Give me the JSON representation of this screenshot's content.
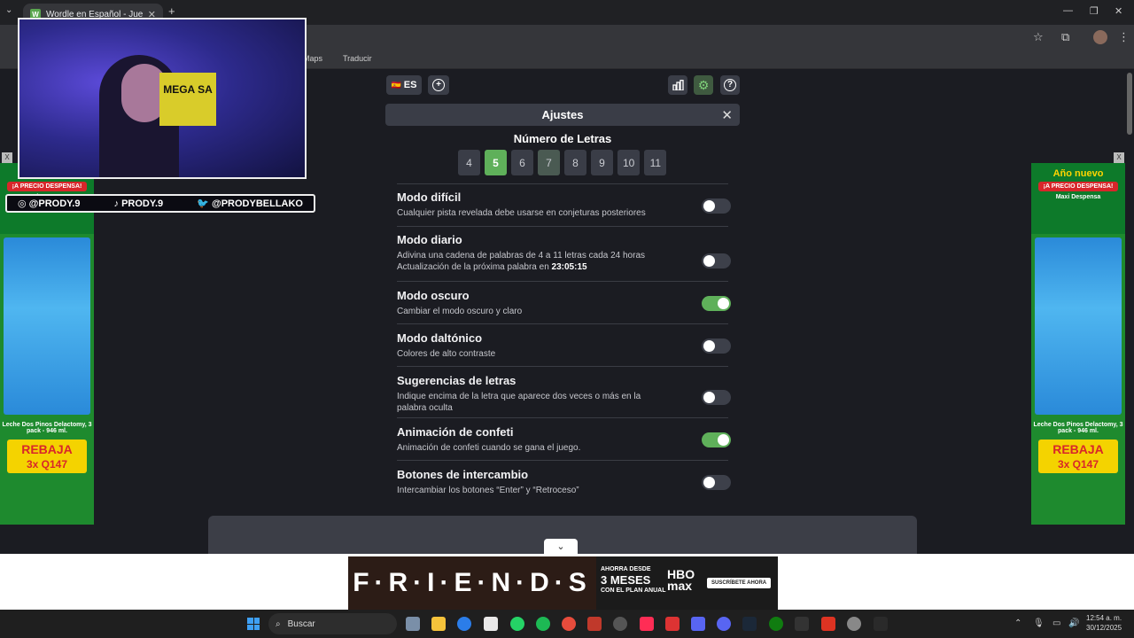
{
  "browser": {
    "tab_title": "Wordle en Español - Juega Wo...",
    "tab_favicon": "W",
    "tab_close": "✕",
    "new_tab": "+",
    "bookmarks": [
      "Maps",
      "Traducir"
    ],
    "window_controls": [
      "—",
      "❐",
      "✕"
    ]
  },
  "toolbar": {
    "lang_flag": "🇪🇸",
    "lang_label": "ES",
    "add_icon": "+",
    "stats_icon": "stats-icon",
    "settings_icon": "gear-icon",
    "help_icon": "?"
  },
  "panel": {
    "title": "Ajustes",
    "close": "✕",
    "letters_title": "Número de Letras",
    "letter_options": [
      "4",
      "5",
      "6",
      "7",
      "8",
      "9",
      "10",
      "11"
    ],
    "selected_letters": "5"
  },
  "settings": [
    {
      "title": "Modo difícil",
      "desc": "Cualquier pista revelada debe usarse en conjeturas posteriores",
      "on": false
    },
    {
      "title": "Modo diario",
      "desc": "Adivina una cadena de palabras de 4 a 11 letras cada 24 horas",
      "desc2_prefix": "Actualización de la próxima palabra en ",
      "desc2_time": "23:05:15",
      "on": false
    },
    {
      "title": "Modo oscuro",
      "desc": "Cambiar el modo oscuro y claro",
      "on": true
    },
    {
      "title": "Modo daltónico",
      "desc": "Colores de alto contraste",
      "on": false
    },
    {
      "title": "Sugerencias de letras",
      "desc": "Indique encima de la letra que aparece dos veces o más en la palabra oculta",
      "on": false
    },
    {
      "title": "Animación de confeti",
      "desc": "Animación de confeti cuando se gana el juego.",
      "on": true
    },
    {
      "title": "Botones de intercambio",
      "desc": "Intercambiar los botones “Enter” y “Retroceso”",
      "on": false
    }
  ],
  "ads": {
    "side_header": "Año nuevo",
    "side_tag": "¡A PRECIO DESPENSA!",
    "side_brand": "Maxi Despensa",
    "side_desc": "Leche Dos Pinos Delactomy, 3 pack - 946 ml.",
    "side_rebaja": "REBAJA",
    "side_price": "3x Q147",
    "bottom_show": "F·R·I·E·N·D·S",
    "bottom_line1": "AHORRA DESDE",
    "bottom_line2": "3 MESES",
    "bottom_line3": "CON EL PLAN ANUAL",
    "bottom_brand": "HBO max",
    "bottom_cta": "SUSCRÍBETE AHORA",
    "close": "X"
  },
  "overlay": {
    "sign": "MEGA SA",
    "socials": [
      "@PRODY.9",
      "PRODY.9",
      "@PRODYBELLAKO"
    ]
  },
  "taskbar": {
    "search_label": "Buscar",
    "time": "12:54 a. m.",
    "date": "30/12/2025"
  },
  "colors": {
    "accent_green": "#5fb05a",
    "panel_bg": "#3a3d47",
    "page_bg": "#1b1c22"
  }
}
